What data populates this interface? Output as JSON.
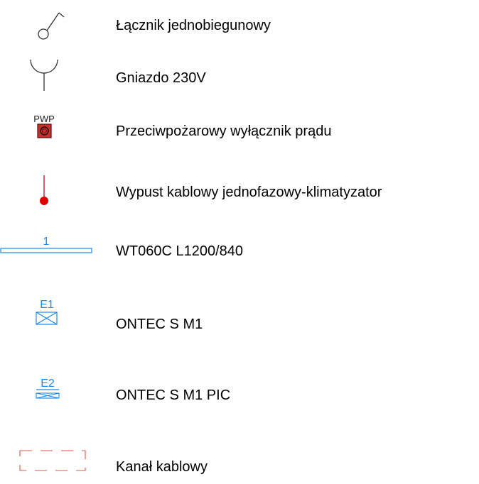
{
  "colors": {
    "symbol_dark": "#333333",
    "symbol_blue": "#1e88e5",
    "symbol_red": "#d0021b",
    "pwp_fill": "#c9302c"
  },
  "legend": {
    "items": [
      {
        "icon": "single-pole-switch-icon",
        "label": "Łącznik jednobiegunowy"
      },
      {
        "icon": "socket-230v-icon",
        "label": "Gniazdo 230V"
      },
      {
        "icon": "fire-power-switch-icon",
        "symbol_text": "PWP",
        "label": "Przeciwpożarowy wyłącznik prądu"
      },
      {
        "icon": "cable-outlet-red-icon",
        "label": "Wypust kablowy jednofazowy-klimatyzator"
      },
      {
        "icon": "luminaire-linear-icon",
        "symbol_text": "1",
        "label": "WT060C L1200/840"
      },
      {
        "icon": "emergency-luminaire-icon",
        "symbol_text": "E1",
        "label": "ONTEC S M1"
      },
      {
        "icon": "emergency-luminaire-pic-icon",
        "symbol_text": "E2",
        "label": "ONTEC S M1 PIC"
      },
      {
        "icon": "cable-channel-dashed-icon",
        "label": "Kanał kablowy"
      }
    ]
  }
}
